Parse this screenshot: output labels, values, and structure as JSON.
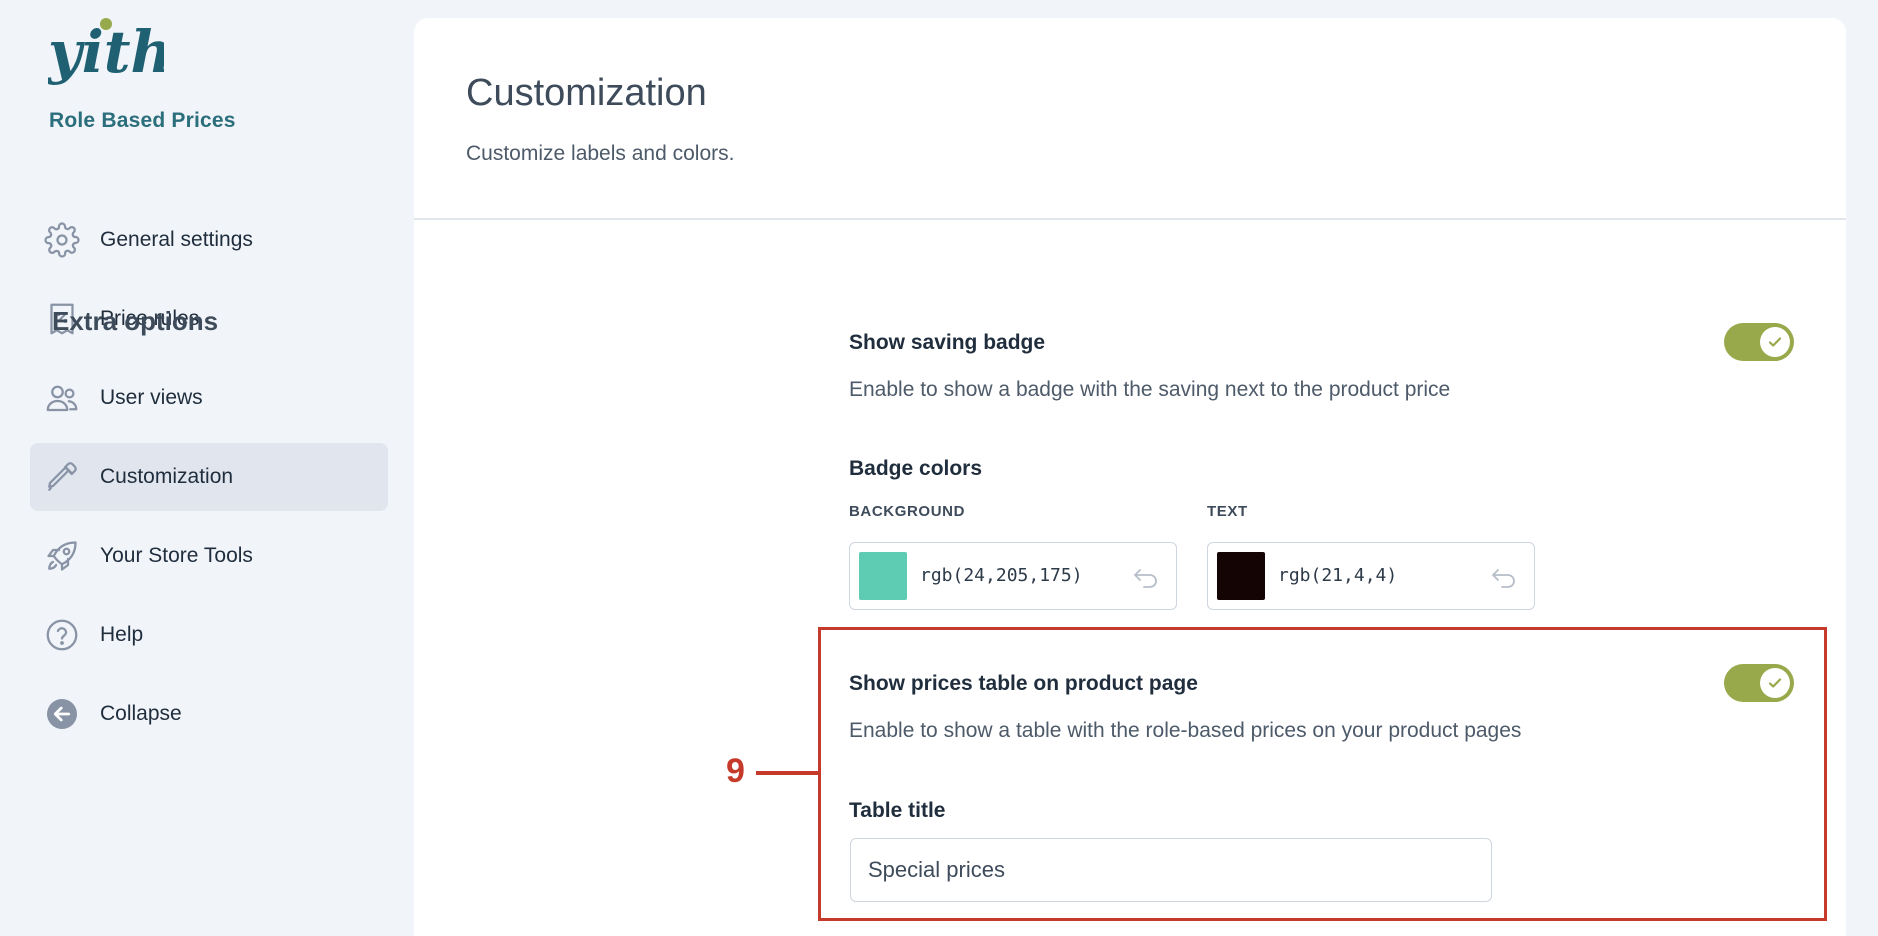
{
  "sidebar": {
    "logo_text": "yith",
    "plugin_name": "Role Based Prices",
    "items": [
      {
        "label": "General settings",
        "icon": "gear-icon",
        "active": false
      },
      {
        "label": "Price rules",
        "icon": "receipt-percent-icon",
        "active": false
      },
      {
        "label": "User views",
        "icon": "users-icon",
        "active": false
      },
      {
        "label": "Customization",
        "icon": "eyedropper-icon",
        "active": true
      },
      {
        "label": "Your Store Tools",
        "icon": "rocket-icon",
        "active": false
      },
      {
        "label": "Help",
        "icon": "question-circle-icon",
        "active": false
      },
      {
        "label": "Collapse",
        "icon": "arrow-left-circle-icon",
        "active": false
      }
    ]
  },
  "main": {
    "title": "Customization",
    "subtitle": "Customize labels and colors.",
    "section_title": "Extra options",
    "saving_badge": {
      "title": "Show saving badge",
      "description": "Enable to show a badge with the saving next to the product price",
      "enabled": true
    },
    "badge_colors": {
      "title": "Badge colors",
      "background": {
        "label": "BACKGROUND",
        "value": "rgb(24,205,175)",
        "swatch": "#5ecbb3"
      },
      "text": {
        "label": "TEXT",
        "value": "rgb(21,4,4)",
        "swatch": "#150404"
      }
    },
    "prices_table": {
      "title": "Show prices table on product page",
      "description": "Enable to show a table with the role-based prices on your product pages",
      "enabled": true
    },
    "table_title": {
      "label": "Table title",
      "value": "Special prices"
    }
  },
  "annotation": {
    "number": "9",
    "color": "#c53a2a"
  },
  "colors": {
    "toggle_on": "#97a94a",
    "brand": "#2b6e7c",
    "active_nav_bg": "#e1e6ee"
  }
}
